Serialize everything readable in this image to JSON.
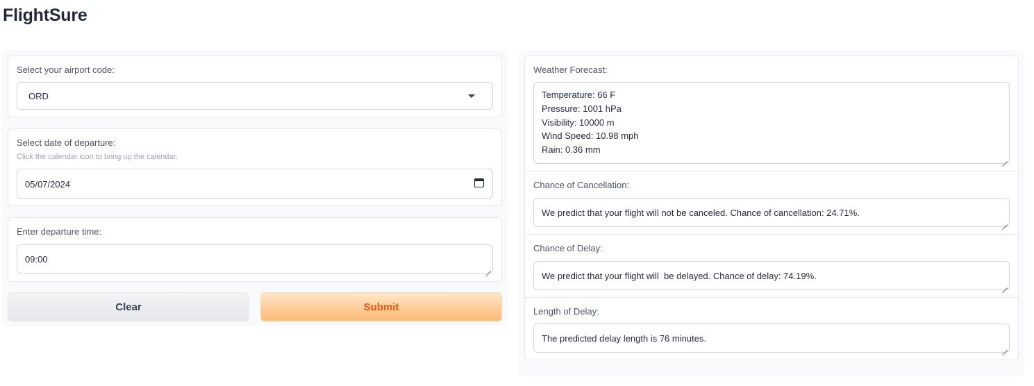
{
  "app": {
    "title": "FlightSure"
  },
  "form": {
    "airport": {
      "label": "Select your airport code:",
      "value": "ORD"
    },
    "date": {
      "label": "Select date of departure:",
      "info": "Click the calendar icon to bring up the calendar.",
      "value": "05/07/2024"
    },
    "time": {
      "label": "Enter departure time:",
      "value": "09:00"
    },
    "buttons": {
      "clear": "Clear",
      "submit": "Submit"
    }
  },
  "results": {
    "weather": {
      "label": "Weather Forecast:",
      "lines": [
        "Temperature: 66 F",
        "Pressure: 1001 hPa",
        "Visibility: 10000 m",
        "Wind Speed: 10.98 mph",
        "Rain: 0.36 mm"
      ]
    },
    "cancellation": {
      "label": "Chance of Cancellation:",
      "value": "We predict that your flight will not be canceled. Chance of cancellation: 24.71%."
    },
    "delay": {
      "label": "Chance of Delay:",
      "value": "We predict that your flight will  be delayed. Chance of delay: 74.19%."
    },
    "length": {
      "label": "Length of Delay:",
      "value": "The predicted delay length is 76 minutes."
    }
  }
}
